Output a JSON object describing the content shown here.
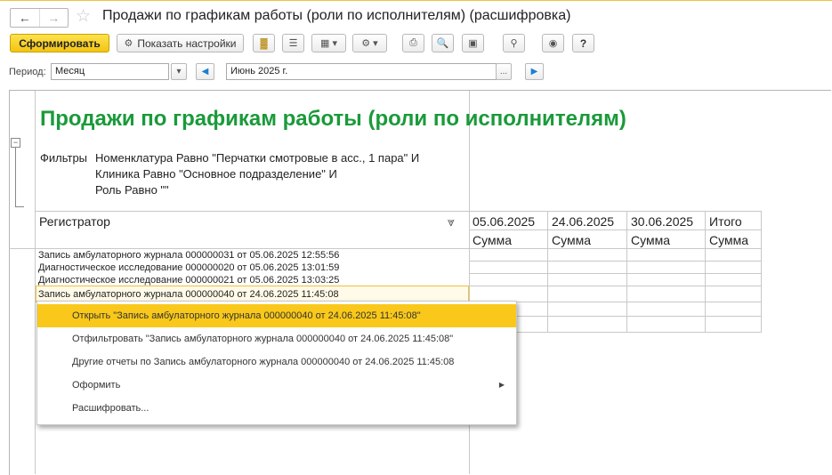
{
  "window": {
    "title": "Продажи по графикам работы (роли по исполнителям) (расшифровка)",
    "back_icon": "left-arrow-icon",
    "forward_icon": "right-arrow-icon",
    "favorite_icon": "star-icon"
  },
  "toolbar": {
    "generate_label": "Сформировать",
    "settings_label": "Показать настройки",
    "help_label": "?"
  },
  "period": {
    "label": "Период:",
    "type_value": "Месяц",
    "date_value": "Июнь 2025 г.",
    "ellipsis": "..."
  },
  "report": {
    "title": "Продажи по графикам работы (роли по исполнителям)",
    "filters_label": "Фильтры",
    "filter_lines": [
      "Номенклатура Равно \"Перчатки смотровые в асс., 1 пара\" И",
      "Клиника Равно \"Основное подразделение\" И",
      "Роль Равно \"\""
    ],
    "registrar_header": "Регистратор",
    "columns": [
      {
        "date": "05.06.2025",
        "sub": "Сумма"
      },
      {
        "date": "24.06.2025",
        "sub": "Сумма"
      },
      {
        "date": "30.06.2025",
        "sub": "Сумма"
      },
      {
        "date": "Итого",
        "sub": "Сумма"
      }
    ],
    "rows": [
      "Запись амбулаторного журнала 000000031 от 05.06.2025 12:55:56",
      "Диагностическое исследование 000000020 от 05.06.2025 13:01:59",
      "Диагностическое исследование 000000021 от 05.06.2025 13:03:25",
      "Запись амбулаторного журнала 000000040 от 24.06.2025 11:45:08"
    ]
  },
  "context_menu": {
    "items": [
      "Открыть \"Запись амбулаторного журнала 000000040 от 24.06.2025 11:45:08\"",
      "Отфильтровать \"Запись амбулаторного журнала 000000040 от 24.06.2025 11:45:08\"",
      "Другие отчеты по Запись амбулаторного журнала 000000040 от 24.06.2025 11:45:08",
      "Оформить",
      "Расшифровать..."
    ]
  },
  "colors": {
    "accent_yellow": "#f9c81a",
    "title_green": "#1a9a3a"
  }
}
